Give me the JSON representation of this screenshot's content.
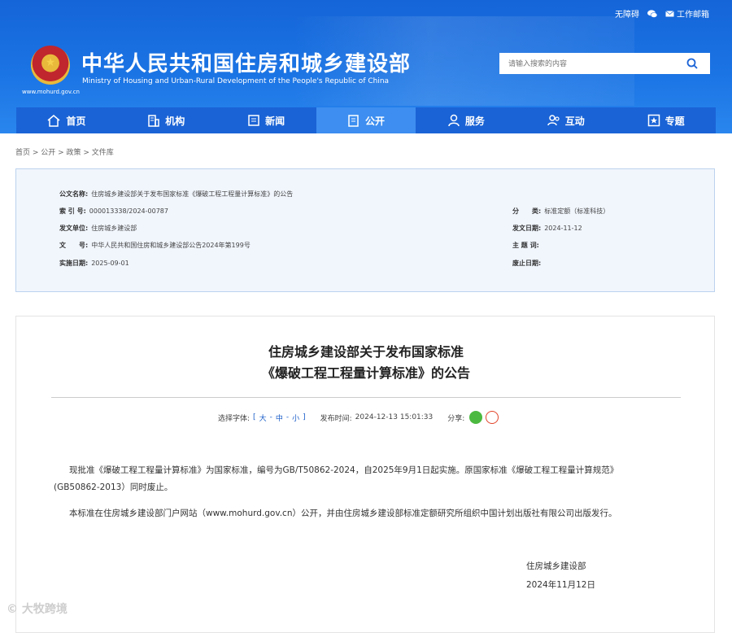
{
  "header": {
    "top_links": [
      "无障碍",
      "工作邮箱"
    ],
    "site_title": "中华人民共和国住房和城乡建设部",
    "site_subtitle": "Ministry of Housing and Urban-Rural Development of the People's Republic of China",
    "site_url": "www.mohurd.gov.cn",
    "search_placeholder": "请输入搜索的内容"
  },
  "nav": [
    {
      "label": "首页",
      "icon": "home-icon"
    },
    {
      "label": "机构",
      "icon": "building-icon"
    },
    {
      "label": "新闻",
      "icon": "news-icon"
    },
    {
      "label": "公开",
      "icon": "document-icon",
      "active": true
    },
    {
      "label": "服务",
      "icon": "user-service-icon"
    },
    {
      "label": "互动",
      "icon": "interact-icon"
    },
    {
      "label": "专题",
      "icon": "star-icon"
    }
  ],
  "breadcrumb": "首页 > 公开 > 政策 > 文件库",
  "info": {
    "title_label": "公文名称:",
    "title_value": "住房城乡建设部关于发布国家标准《爆破工程工程量计算标准》的公告",
    "index_label": "索 引 号:",
    "index_value": "000013338/2024-00787",
    "category_label": "分　　类:",
    "category_value": "标准定额（标准科技）",
    "issuer_label": "发文单位:",
    "issuer_value": "住房城乡建设部",
    "date_label": "发文日期:",
    "date_value": "2024-11-12",
    "docno_label": "文　　号:",
    "docno_value": "中华人民共和国住房和城乡建设部公告2024年第199号",
    "subject_label": "主 题 词:",
    "subject_value": "",
    "effective_label": "实施日期:",
    "effective_value": "2025-09-01",
    "repeal_label": "废止日期:",
    "repeal_value": ""
  },
  "article": {
    "title_line1": "住房城乡建设部关于发布国家标准",
    "title_line2": "《爆破工程工程量计算标准》的公告",
    "font_label": "选择字体:",
    "font_open": "[",
    "font_large": "大",
    "font_medium": "中",
    "font_small": "小",
    "font_close": "]",
    "sep": "-",
    "publish_label": "发布时间:",
    "publish_time": "2024-12-13 15:01:33",
    "share_label": "分享:",
    "para1_line1": "现批准《爆破工程工程量计算标准》为国家标准，编号为GB/T50862-2024，自2025年9月1日起实施。原国家标准《爆破工程工程量计算规范》",
    "para1_line2": "(GB50862-2013）同时废止。",
    "para2": "本标准在住房城乡建设部门户网站（www.mohurd.gov.cn）公开，并由住房城乡建设部标准定额研究所组织中国计划出版社有限公司出版发行。",
    "signature": "住房城乡建设部",
    "sign_date": "2024年11月12日"
  },
  "watermark": "大牧跨境"
}
